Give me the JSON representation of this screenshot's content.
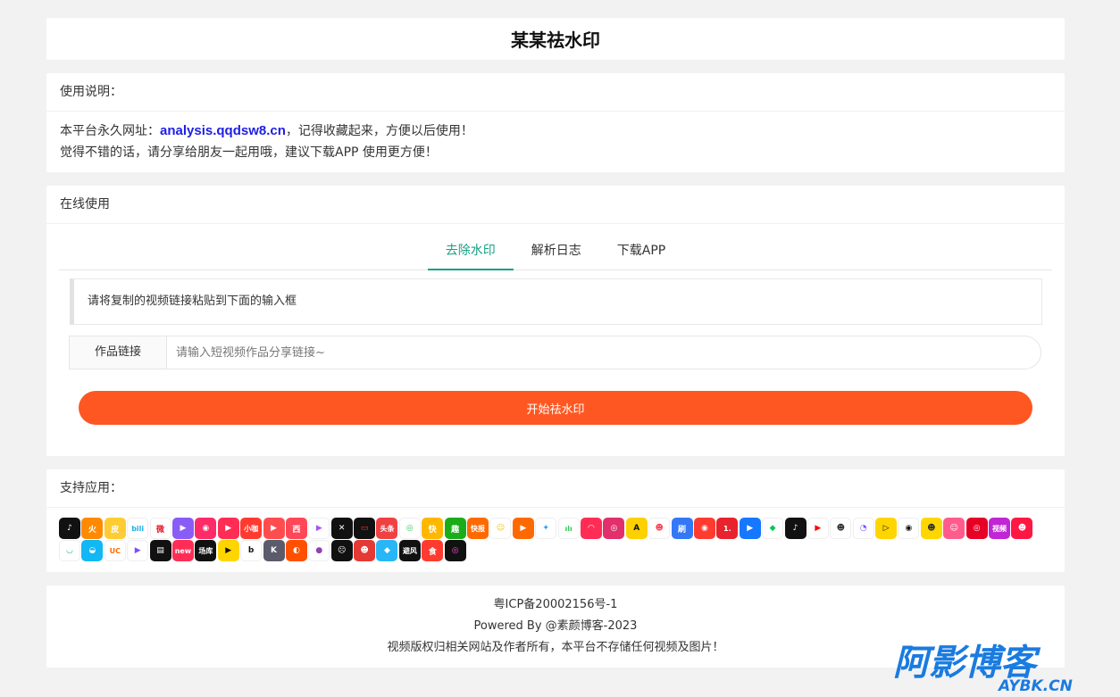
{
  "title": "某某祛水印",
  "usage": {
    "heading": "使用说明：",
    "line1_prefix": "本平台永久网址：",
    "url": "analysis.qqdsw8.cn",
    "line1_suffix": "，记得收藏起来，方便以后使用！",
    "line2": "觉得不错的话，请分享给朋友一起用哦，建议下载APP 使用更方便！"
  },
  "online": {
    "heading": "在线使用",
    "tabs": [
      "去除水印",
      "解析日志",
      "下载APP"
    ],
    "tip": "请将复制的视频链接粘贴到下面的输入框",
    "field_label": "作品链接",
    "placeholder": "请输入短视频作品分享链接~",
    "button": "开始祛水印"
  },
  "apps": {
    "heading": "支持应用：",
    "icons": [
      {
        "name": "douyin-icon",
        "bg": "#111111",
        "t": "♪"
      },
      {
        "name": "huoshan-icon",
        "bg": "#ff8a00",
        "t": "火"
      },
      {
        "name": "pipixia-icon",
        "bg": "#ffcc33",
        "t": "皮"
      },
      {
        "name": "bilibili-icon",
        "bg": "#ffffff",
        "t": "bili",
        "c": "#23ade5"
      },
      {
        "name": "weibo-icon",
        "bg": "#ffffff",
        "t": "微",
        "c": "#e6162d"
      },
      {
        "name": "weishi-icon",
        "bg": "#8a5cf6",
        "t": "▶"
      },
      {
        "name": "meipai-icon",
        "bg": "#ff2a68",
        "t": "◉"
      },
      {
        "name": "haokan-icon",
        "bg": "#ff2d55",
        "t": "▶"
      },
      {
        "name": "xiaokaxiu-icon",
        "bg": "#ff3b30",
        "t": "小咖"
      },
      {
        "name": "zuiyou-icon",
        "bg": "#ff4d4f",
        "t": "▶"
      },
      {
        "name": "xigua-icon",
        "bg": "#ff4757",
        "t": "西"
      },
      {
        "name": "quanmin-icon",
        "bg": "#ffffff",
        "t": "▶",
        "c": "#a855f7"
      },
      {
        "name": "jianying-icon",
        "bg": "#111111",
        "t": "✕"
      },
      {
        "name": "duanzi-icon",
        "bg": "#111111",
        "t": "▭",
        "c": "#ff3b30"
      },
      {
        "name": "toutiao-icon",
        "bg": "#f04142",
        "t": "头条"
      },
      {
        "name": "lvzhou-icon",
        "bg": "#ffffff",
        "t": "◎",
        "c": "#34c759"
      },
      {
        "name": "kuai-icon",
        "bg": "#ffb800",
        "t": "快"
      },
      {
        "name": "qutoutiao-icon",
        "bg": "#1aad19",
        "t": "趣"
      },
      {
        "name": "kuaibao-icon",
        "bg": "#ff6a00",
        "t": "快报"
      },
      {
        "name": "qq-kankan-icon",
        "bg": "#ffffff",
        "t": "☺",
        "c": "#f5c400"
      },
      {
        "name": "youku-icon",
        "bg": "#ff6a00",
        "t": "▶"
      },
      {
        "name": "twitter-icon",
        "bg": "#ffffff",
        "t": "✦",
        "c": "#1da1f2"
      },
      {
        "name": "lvyou-icon",
        "bg": "#ffffff",
        "t": "ılı",
        "c": "#34c759"
      },
      {
        "name": "momo-icon",
        "bg": "#ff2d55",
        "t": "◠"
      },
      {
        "name": "instagram-icon",
        "bg": "#e1306c",
        "t": "◎"
      },
      {
        "name": "acfun-icon",
        "bg": "#fdd000",
        "t": "A",
        "c": "#111111"
      },
      {
        "name": "face-icon",
        "bg": "#ffffff",
        "t": "☻",
        "c": "#ff4757"
      },
      {
        "name": "shua-icon",
        "bg": "#3478f6",
        "t": "刷"
      },
      {
        "name": "live-icon",
        "bg": "#ff3b30",
        "t": "◉"
      },
      {
        "name": "yi-icon",
        "bg": "#e8232e",
        "t": "1."
      },
      {
        "name": "play-icon",
        "bg": "#1677ff",
        "t": "▶"
      },
      {
        "name": "iqiyi-icon",
        "bg": "#ffffff",
        "t": "◆",
        "c": "#00c853"
      },
      {
        "name": "tiktok-icon",
        "bg": "#111111",
        "t": "♪"
      },
      {
        "name": "youtube-icon",
        "bg": "#ffffff",
        "t": "▶",
        "c": "#ff0000"
      },
      {
        "name": "maomao-icon",
        "bg": "#ffffff",
        "t": "☻",
        "c": "#333333"
      },
      {
        "name": "chat-icon",
        "bg": "#ffffff",
        "t": "◔",
        "c": "#7c4dff"
      },
      {
        "name": "yellow-play-icon",
        "bg": "#ffd500",
        "t": "▷",
        "c": "#111111"
      },
      {
        "name": "camera-icon",
        "bg": "#ffffff",
        "t": "◉",
        "c": "#111111"
      },
      {
        "name": "meme-icon",
        "bg": "#ffd700",
        "t": "☻",
        "c": "#333333"
      },
      {
        "name": "girl-icon",
        "bg": "#ff5c8d",
        "t": "☺"
      },
      {
        "name": "netease-icon",
        "bg": "#e60026",
        "t": "◎"
      },
      {
        "name": "shipin-icon",
        "bg": "#c026d3",
        "t": "视频"
      },
      {
        "name": "mask-icon",
        "bg": "#ff1744",
        "t": "☻"
      },
      {
        "name": "bowl-icon",
        "bg": "#ffffff",
        "t": "◡",
        "c": "#26a69a"
      },
      {
        "name": "qq-icon",
        "bg": "#12b7f5",
        "t": "◒"
      },
      {
        "name": "uc-icon",
        "bg": "#ffffff",
        "t": "UC",
        "c": "#ff6a00"
      },
      {
        "name": "tencent-video-icon",
        "bg": "#ffffff",
        "t": "▶",
        "c": "#7c4dff"
      },
      {
        "name": "stripe-icon",
        "bg": "#111111",
        "t": "▤"
      },
      {
        "name": "new-icon",
        "bg": "#ff2d55",
        "t": "new"
      },
      {
        "name": "changku-icon",
        "bg": "#111111",
        "t": "场库"
      },
      {
        "name": "circle-play-icon",
        "bg": "#ffd500",
        "t": "▶",
        "c": "#111111"
      },
      {
        "name": "b-icon",
        "bg": "#ffffff",
        "t": "b",
        "c": "#111111"
      },
      {
        "name": "k-icon",
        "bg": "#5b5b6b",
        "t": "K"
      },
      {
        "name": "kuaishou-icon",
        "bg": "#ff5000",
        "t": "◐"
      },
      {
        "name": "ball-icon",
        "bg": "#ffffff",
        "t": "●",
        "c": "#8e44ad"
      },
      {
        "name": "face-black-icon",
        "bg": "#111111",
        "t": "☹"
      },
      {
        "name": "monkey-icon",
        "bg": "#e53935",
        "t": "☻"
      },
      {
        "name": "drop-icon",
        "bg": "#29b6f6",
        "t": "◆"
      },
      {
        "name": "bifeng-icon",
        "bg": "#111111",
        "t": "避风"
      },
      {
        "name": "shi-icon",
        "bg": "#ff3b30",
        "t": "食"
      },
      {
        "name": "ring-icon",
        "bg": "#111111",
        "t": "◎",
        "c": "#ff4fd8"
      }
    ]
  },
  "footer": {
    "icp": "粤ICP备20002156号-1",
    "powered": "Powered By @素颜博客-2023",
    "notice": "视频版权归相关网站及作者所有，本平台不存储任何视频及图片！"
  },
  "watermark": {
    "text_cn": "阿影博客",
    "text_en": "AYBK.CN",
    "color": "#1a7be0"
  }
}
